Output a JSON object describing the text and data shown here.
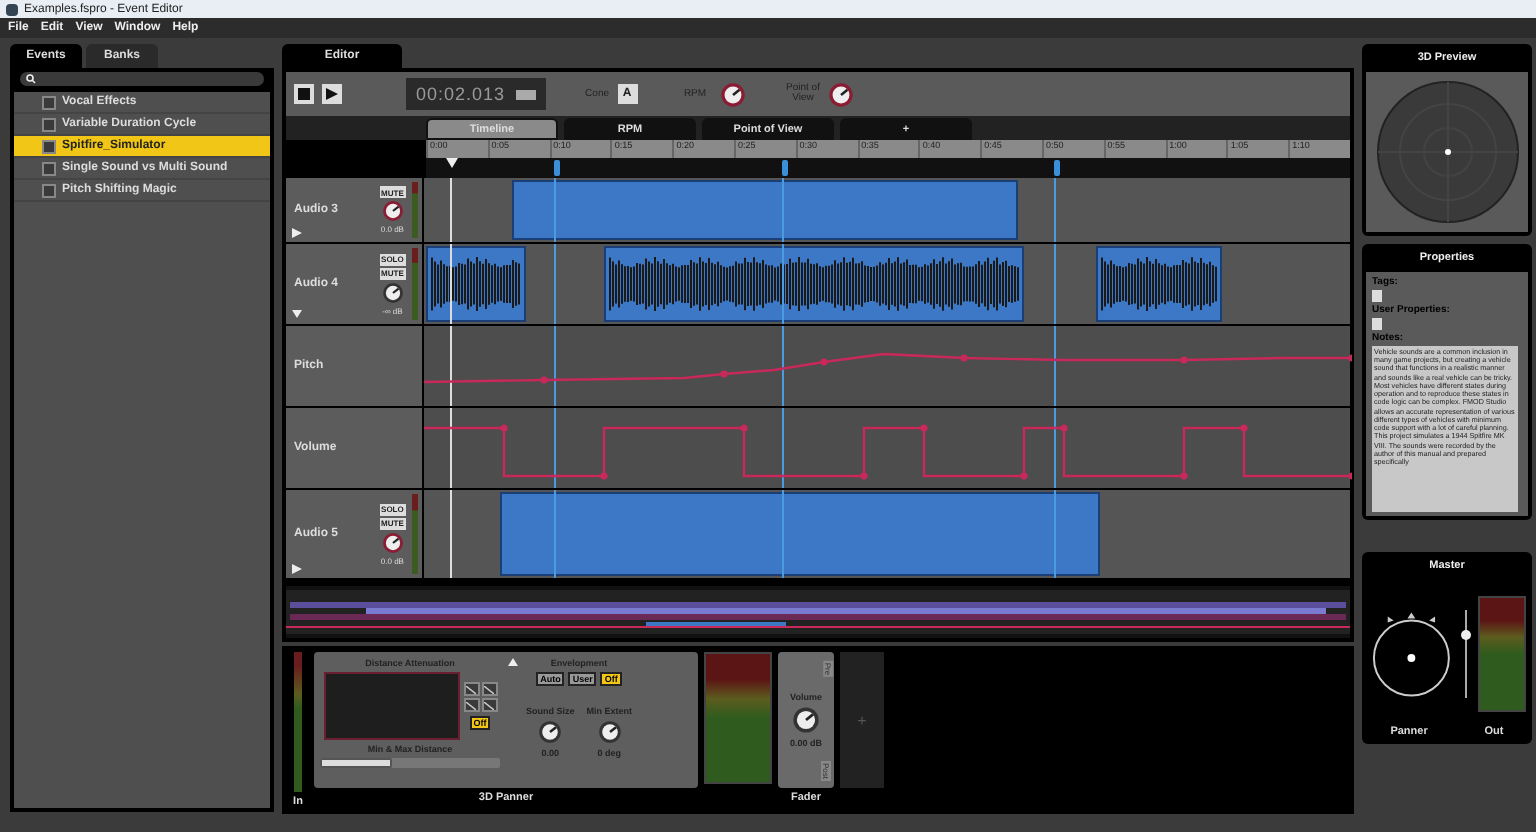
{
  "window": {
    "title": "Examples.fspro - Event Editor"
  },
  "menu": [
    "File",
    "Edit",
    "View",
    "Window",
    "Help"
  ],
  "browser": {
    "tabs": [
      {
        "label": "Events",
        "selected": true
      },
      {
        "label": "Banks",
        "selected": false
      }
    ],
    "items": [
      {
        "label": "Vocal Effects",
        "selected": false
      },
      {
        "label": "Variable Duration Cycle",
        "selected": false
      },
      {
        "label": "Spitfire_Simulator",
        "selected": true
      },
      {
        "label": "Single Sound vs Multi Sound",
        "selected": false
      },
      {
        "label": "Pitch Shifting Magic",
        "selected": false
      }
    ]
  },
  "editor": {
    "tab": "Editor",
    "time": "00:02.013",
    "cone_label": "Cone",
    "cone_value": "A",
    "knobs": [
      {
        "label": "RPM"
      },
      {
        "label": "Point of View"
      }
    ],
    "tabs": [
      {
        "label": "Timeline",
        "selected": true
      },
      {
        "label": "RPM",
        "selected": false
      },
      {
        "label": "Point of View",
        "selected": false
      },
      {
        "label": "+",
        "selected": false
      }
    ],
    "ruler": [
      "0:00",
      "0:05",
      "0:10",
      "0:15",
      "0:20",
      "0:25",
      "0:30",
      "0:35",
      "0:40",
      "0:45",
      "0:50",
      "0:55",
      "1:00",
      "1:05",
      "1:10"
    ],
    "tracks": [
      {
        "kind": "audio",
        "name": "Audio 3",
        "buttons": [
          "MUTE"
        ],
        "gain": "0.0 dB",
        "expanded": false
      },
      {
        "kind": "audio",
        "name": "Audio 4",
        "buttons": [
          "SOLO",
          "MUTE"
        ],
        "gain": "-∞ dB",
        "expanded": true
      },
      {
        "kind": "automation",
        "name": "Pitch"
      },
      {
        "kind": "automation",
        "name": "Volume"
      },
      {
        "kind": "audio",
        "name": "Audio 5",
        "buttons": [
          "SOLO",
          "MUTE"
        ],
        "gain": "0.0 dB",
        "expanded": false
      }
    ]
  },
  "deck": {
    "input_label": "In",
    "panner": {
      "title": "3D Panner",
      "attenuation_label": "Distance Attenuation",
      "attenuation_off": {
        "label": "Off",
        "on": true
      },
      "distance_label": "Min & Max Distance",
      "distance": {
        "level": 0.4
      },
      "envelopment_label": "Envelopment",
      "envelopment": [
        {
          "label": "Auto",
          "selected": false
        },
        {
          "label": "User",
          "selected": false
        },
        {
          "label": "Off",
          "selected": true
        }
      ],
      "sound_size": {
        "label": "Sound Size",
        "value": "0.00"
      },
      "min_extent": {
        "label": "Min Extent",
        "value": "0 deg"
      }
    },
    "fader": {
      "title": "Fader",
      "pre": "Pre",
      "post": "Post",
      "label": "Volume",
      "value": "0.00 dB"
    },
    "add": "+"
  },
  "preview": {
    "title": "3D Preview"
  },
  "properties": {
    "title": "Properties",
    "tags_label": "Tags:",
    "user_label": "User Properties:",
    "notes_label": "Notes:",
    "notes": "Vehicle sounds are a common inclusion in many game projects, but creating a vehicle sound that functions in a realistic manner and sounds like a real vehicle can be tricky. Most vehicles have different states during operation and to reproduce these states in code logic can be complex. FMOD Studio allows an accurate representation of various different types of vehicles with minimum code support with a lot of careful planning. This project simulates a 1944 Spitfire MK VIII. The sounds were recorded by the author of this manual and prepared specifically"
  },
  "master": {
    "title": "Master",
    "panner": "Panner",
    "out": "Out",
    "fader": {
      "level": 0.75
    }
  }
}
